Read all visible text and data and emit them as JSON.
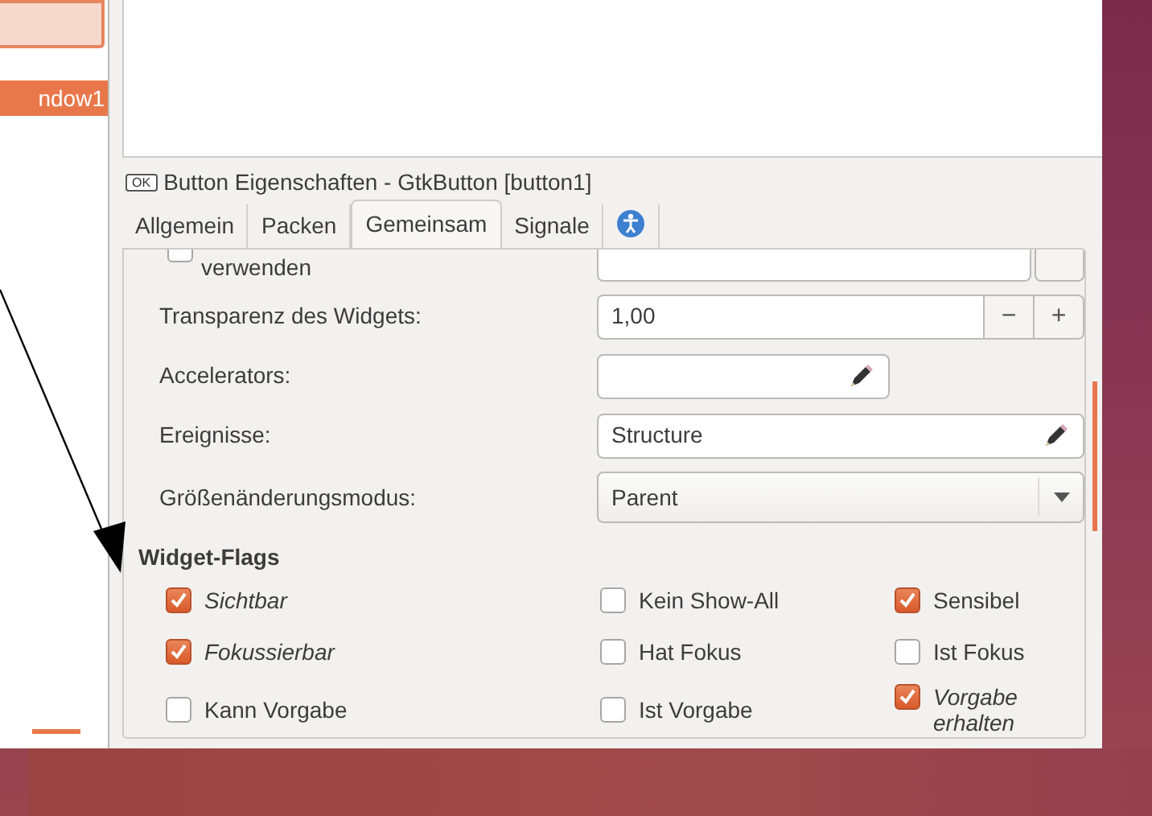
{
  "tree": {
    "item": {
      "label": "ndow1",
      "selected": true
    }
  },
  "editor_title": {
    "icon_text": "OK",
    "text": "Button Eigenschaften - GtkButton [button1]"
  },
  "tabs": [
    {
      "kind": "text",
      "label": "Allgemein",
      "selected": false
    },
    {
      "kind": "text",
      "label": "Packen",
      "selected": false
    },
    {
      "kind": "text",
      "label": "Gemeinsam",
      "selected": true
    },
    {
      "kind": "text",
      "label": "Signale",
      "selected": false
    },
    {
      "kind": "accessibility",
      "selected": false
    }
  ],
  "properties": [
    {
      "kind": "check_field",
      "label": "verwenden",
      "checked": false
    },
    {
      "kind": "spin",
      "label": "Transparenz des Widgets:",
      "value": "1,00",
      "minus": "−",
      "plus": "+"
    },
    {
      "kind": "edit_short",
      "label": "Accelerators:"
    },
    {
      "kind": "edit",
      "label": "Ereignisse:",
      "value": "Structure"
    },
    {
      "kind": "combo",
      "label": "Größenänderungsmodus:",
      "value": "Parent"
    }
  ],
  "flags_heading": "Widget-Flags",
  "flags": [
    {
      "label": "Sichtbar",
      "checked": true,
      "italic": true
    },
    {
      "label": "Kein Show-All",
      "checked": false,
      "italic": false
    },
    {
      "label": "Sensibel",
      "checked": true,
      "italic": false
    },
    {
      "label": "Fokussierbar",
      "checked": true,
      "italic": true
    },
    {
      "label": "Hat Fokus",
      "checked": false,
      "italic": false
    },
    {
      "label": "Ist Fokus",
      "checked": false,
      "italic": false
    },
    {
      "label": "Kann Vorgabe",
      "checked": false,
      "italic": false
    },
    {
      "label": "Ist Vorgabe",
      "checked": false,
      "italic": false
    },
    {
      "label": "Vorgabe erhalten",
      "checked": true,
      "italic": true
    }
  ]
}
